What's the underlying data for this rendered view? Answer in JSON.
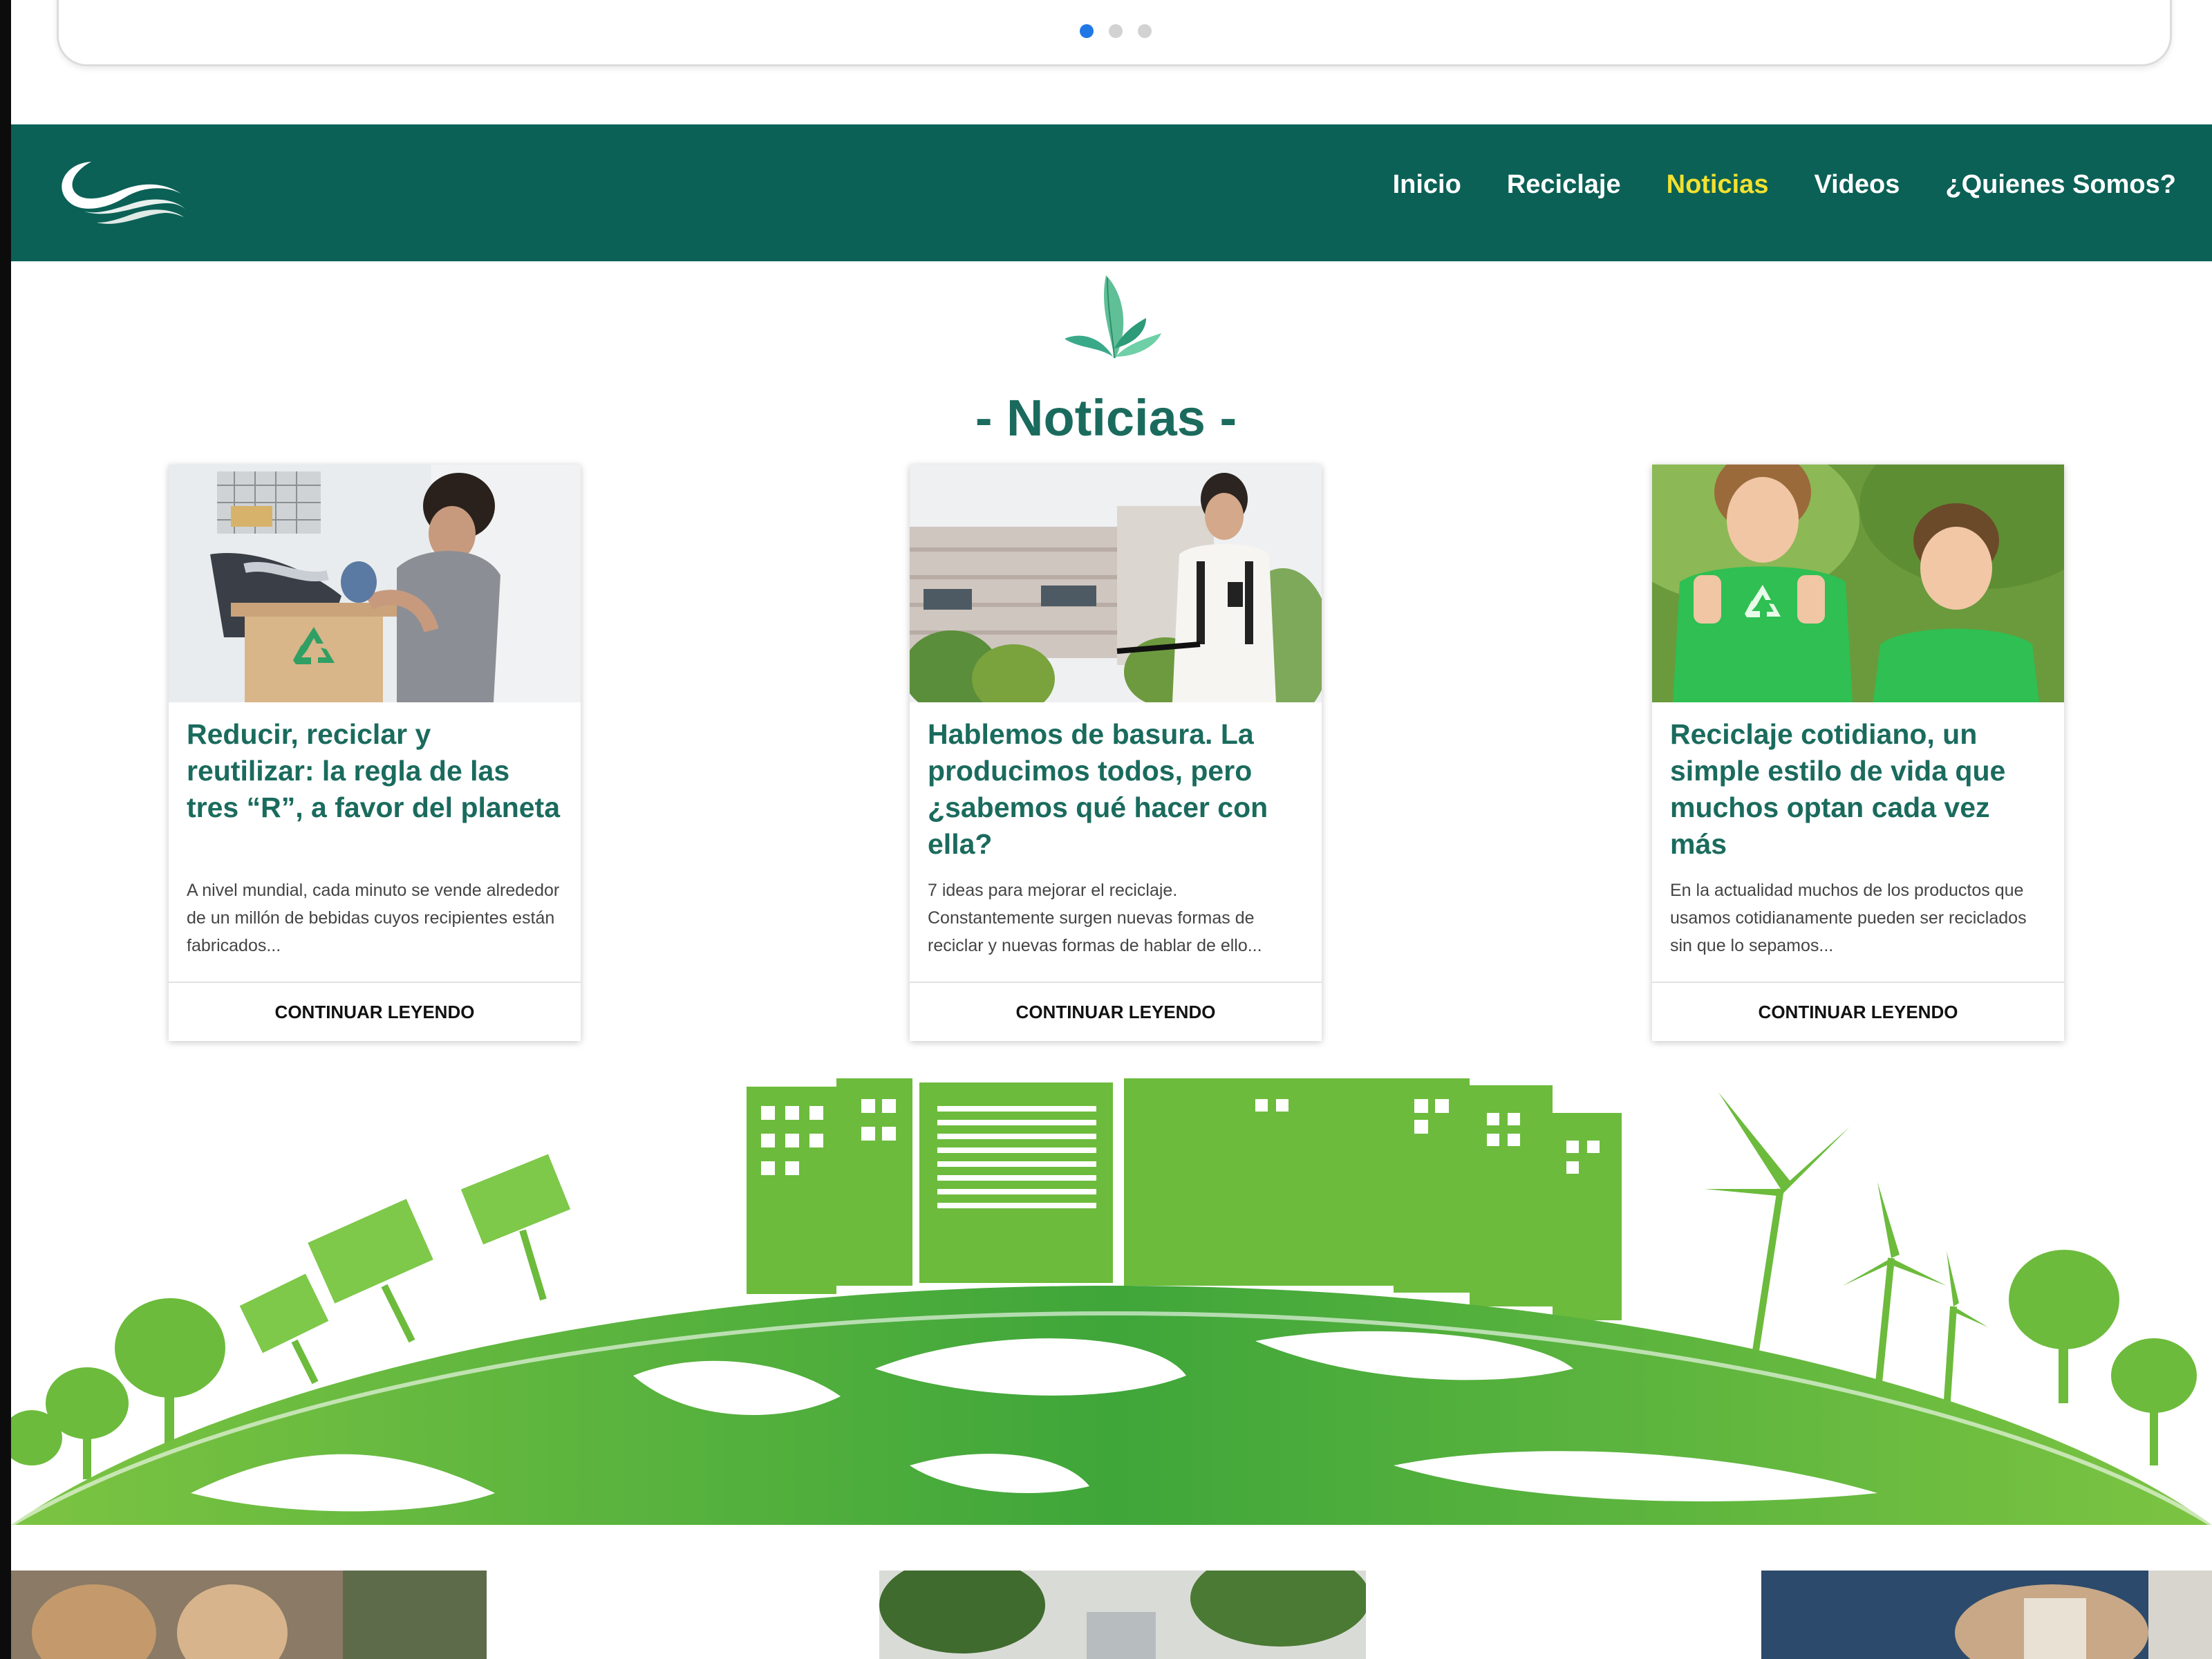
{
  "carousel": {
    "dots": 3,
    "active_dot": 1
  },
  "nav": {
    "logo": "wave-logo",
    "links": [
      {
        "label": "Inicio",
        "active": false
      },
      {
        "label": "Reciclaje",
        "active": false
      },
      {
        "label": "Noticias",
        "active": true
      },
      {
        "label": "Videos",
        "active": false
      },
      {
        "label": "¿Quienes Somos?",
        "active": false
      }
    ]
  },
  "section": {
    "title": "- Noticias -",
    "icon": "leaf-icon"
  },
  "cards": [
    {
      "image": "woman-recycling-box",
      "title": "Reducir, reciclar y reutilizar: la regla de las tres “R”, a favor del planeta",
      "excerpt": "A nivel mundial, cada minuto se vende alrededor de un millón de bebidas cuyos recipientes están fabricados...",
      "button": "CONTINUAR LEYENDO"
    },
    {
      "image": "man-with-bicycle",
      "title": "Hablemos de basura. La producimos todos, pero ¿sabemos qué hacer con ella?",
      "excerpt": "7 ideas para mejorar el reciclaje. Constantemente surgen nuevas formas de reciclar y nuevas formas de hablar de ello...",
      "button": "CONTINUAR LEYENDO"
    },
    {
      "image": "kids-thumbs-up",
      "title": "Reciclaje cotidiano, un simple estilo de vida que muchos optan cada vez más",
      "excerpt": "En la actualidad muchos de los productos que usamos cotidianamente pueden ser reciclados sin que lo sepamos...",
      "button": "CONTINUAR LEYENDO"
    }
  ],
  "banner": {
    "image": "green-earth-city-illustration"
  },
  "colors": {
    "nav_bg": "#0b6156",
    "nav_active": "#f3e12f",
    "title": "#1a6b5d",
    "eco_green": "#5cb82e"
  }
}
